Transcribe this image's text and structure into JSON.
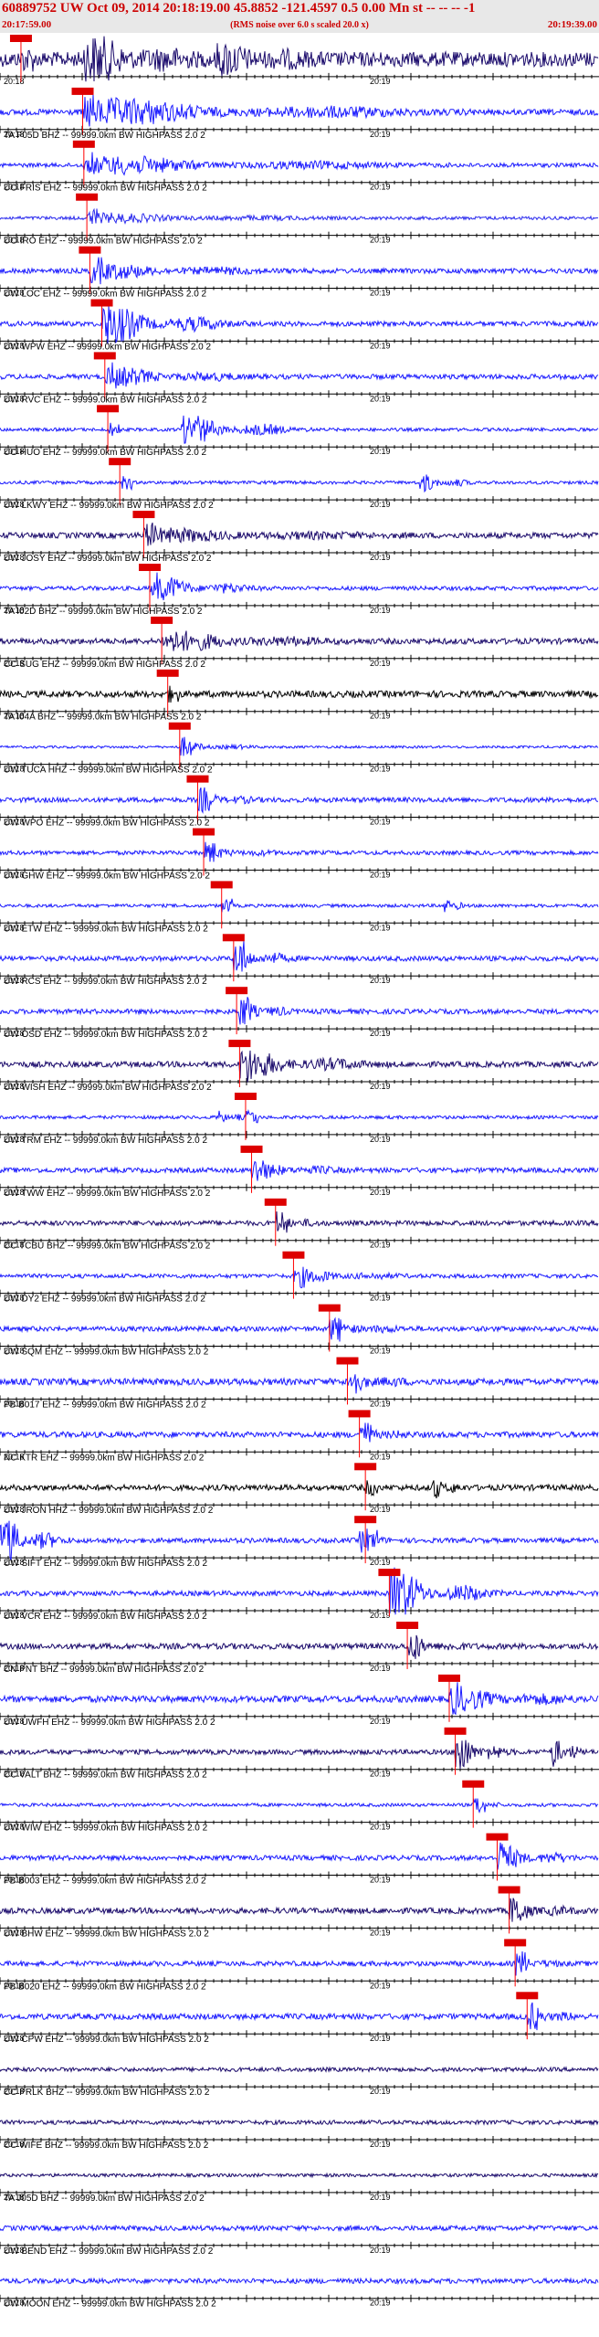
{
  "header": {
    "title": "60889752 UW Oct 09, 2014 20:18:19.00   45.8852 -121.4597  0.5 0.00 Mn st -- -- --  -1",
    "start_time": "20:17:59.00",
    "end_time": "20:19:39.00",
    "note": "(RMS noise over 6.0 s scaled 20.0 x)"
  },
  "ticks": {
    "left_label": "20:18",
    "right_label": "20:19"
  },
  "channels": [
    {
      "label": "",
      "color": "#1a0a6b",
      "pick": 0.035,
      "amp": 0.9,
      "bursts": [
        [
          0.14,
          0.36,
          1.4
        ],
        [
          0.36,
          0.55,
          0.9
        ]
      ]
    },
    {
      "label": "TA F05D BHZ -- 99999.0km BW  HIGHPASS  2.0  2",
      "color": "#1a1aff",
      "pick": 0.138,
      "amp": 0.35,
      "bursts": [
        [
          0.14,
          0.8,
          0.9
        ]
      ]
    },
    {
      "label": "UO FRIS EHZ -- 99999.0km BW  HIGHPASS  2.0  2",
      "color": "#1a1aff",
      "pick": 0.14,
      "amp": 0.25,
      "bursts": [
        [
          0.15,
          0.75,
          0.6
        ]
      ]
    },
    {
      "label": "UO IRO EHZ -- 99999.0km BW  HIGHPASS  2.0  2",
      "color": "#2a2aee",
      "pick": 0.145,
      "amp": 0.2,
      "bursts": [
        [
          0.15,
          0.6,
          0.3
        ]
      ]
    },
    {
      "label": "UW LOC EHZ -- 99999.0km BW  HIGHPASS  2.0  2",
      "color": "#1a1aff",
      "pick": 0.15,
      "amp": 0.3,
      "bursts": [
        [
          0.15,
          0.5,
          0.5
        ]
      ]
    },
    {
      "label": "UW WPW EHZ -- 99999.0km BW  HIGHPASS  2.0  2",
      "color": "#1a1aff",
      "pick": 0.17,
      "amp": 0.3,
      "bursts": [
        [
          0.17,
          0.42,
          1.3
        ]
      ]
    },
    {
      "label": "UW RVC EHZ -- 99999.0km BW  HIGHPASS  2.0  2",
      "color": "#1a1aff",
      "pick": 0.175,
      "amp": 0.3,
      "bursts": [
        [
          0.18,
          0.45,
          0.6
        ]
      ]
    },
    {
      "label": "UO HUO EHZ -- 99999.0km BW  HIGHPASS  2.0  2",
      "color": "#1a1aff",
      "pick": 0.18,
      "amp": 0.2,
      "bursts": [
        [
          0.3,
          0.52,
          1.1
        ]
      ]
    },
    {
      "label": "UW LKWY EHZ -- 99999.0km BW  HIGHPASS  2.0  2",
      "color": "#1a1aff",
      "pick": 0.2,
      "amp": 0.2,
      "bursts": [
        [
          0.7,
          0.8,
          0.6
        ]
      ]
    },
    {
      "label": "UW JOSY EHZ -- 99999.0km BW  HIGHPASS  2.0  2",
      "color": "#1a0a6b",
      "pick": 0.24,
      "amp": 0.35,
      "bursts": [
        [
          0.24,
          0.7,
          0.4
        ]
      ]
    },
    {
      "label": "TA I02D BHZ -- 99999.0km BW  HIGHPASS  2.0  2",
      "color": "#1a1aff",
      "pick": 0.25,
      "amp": 0.25,
      "bursts": [
        [
          0.26,
          0.45,
          0.8
        ]
      ]
    },
    {
      "label": "CC SUG EHZ -- 99999.0km BW  HIGHPASS  2.0  2",
      "color": "#1a0a6b",
      "pick": 0.27,
      "amp": 0.35,
      "bursts": [
        [
          0.28,
          0.6,
          0.6
        ]
      ]
    },
    {
      "label": "TA I04A BHZ -- 99999.0km BW  HIGHPASS  2.0  2",
      "color": "#000000",
      "pick": 0.28,
      "amp": 0.4,
      "bursts": []
    },
    {
      "label": "UW TUCA HHZ -- 99999.0km BW  HIGHPASS  2.0  2",
      "color": "#1a1aff",
      "pick": 0.3,
      "amp": 0.15,
      "bursts": [
        [
          0.3,
          0.45,
          0.3
        ]
      ]
    },
    {
      "label": "UW WPO EHZ -- 99999.0km BW  HIGHPASS  2.0  2",
      "color": "#1a1aff",
      "pick": 0.33,
      "amp": 0.3,
      "bursts": [
        [
          0.33,
          0.45,
          0.4
        ]
      ]
    },
    {
      "label": "UW GHW EHZ -- 99999.0km BW  HIGHPASS  2.0  2",
      "color": "#1a1aff",
      "pick": 0.34,
      "amp": 0.25,
      "bursts": [
        [
          0.34,
          0.5,
          0.3
        ]
      ]
    },
    {
      "label": "UW ETW EHZ -- 99999.0km BW  HIGHPASS  2.0  2",
      "color": "#1a1aff",
      "pick": 0.37,
      "amp": 0.2,
      "bursts": [
        [
          0.74,
          0.78,
          0.6
        ]
      ]
    },
    {
      "label": "UW RCS EHZ -- 99999.0km BW  HIGHPASS  2.0  2",
      "color": "#1a1aff",
      "pick": 0.39,
      "amp": 0.3,
      "bursts": [
        [
          0.39,
          0.5,
          0.9
        ]
      ]
    },
    {
      "label": "UW OSD EHZ -- 99999.0km BW  HIGHPASS  2.0  2",
      "color": "#1a1aff",
      "pick": 0.395,
      "amp": 0.3,
      "bursts": [
        [
          0.4,
          0.5,
          0.7
        ]
      ]
    },
    {
      "label": "UW WISH EHZ -- 99999.0km BW  HIGHPASS  2.0  2",
      "color": "#1a0a6b",
      "pick": 0.4,
      "amp": 0.35,
      "bursts": [
        [
          0.4,
          0.65,
          0.9
        ]
      ]
    },
    {
      "label": "UW TRM EHZ -- 99999.0km BW  HIGHPASS  2.0  2",
      "color": "#1a1aff",
      "pick": 0.41,
      "amp": 0.2,
      "bursts": [
        [
          0.36,
          0.42,
          0.4
        ]
      ]
    },
    {
      "label": "UW TWW EHZ -- 99999.0km BW  HIGHPASS  2.0  2",
      "color": "#1a1aff",
      "pick": 0.42,
      "amp": 0.3,
      "bursts": [
        [
          0.42,
          0.6,
          0.5
        ]
      ]
    },
    {
      "label": "CC TCBU BHZ -- 99999.0km BW  HIGHPASS  2.0  2",
      "color": "#1a0a6b",
      "pick": 0.46,
      "amp": 0.3,
      "bursts": [
        [
          0.46,
          0.55,
          0.4
        ]
      ]
    },
    {
      "label": "UW DY2 EHZ -- 99999.0km BW  HIGHPASS  2.0  2",
      "color": "#1a1aff",
      "pick": 0.49,
      "amp": 0.25,
      "bursts": [
        [
          0.5,
          0.7,
          0.4
        ]
      ]
    },
    {
      "label": "UW SQM EHZ -- 99999.0km BW  HIGHPASS  2.0  2",
      "color": "#1a1aff",
      "pick": 0.55,
      "amp": 0.3,
      "bursts": [
        [
          0.55,
          0.7,
          0.4
        ]
      ]
    },
    {
      "label": "PB B017 EHZ -- 99999.0km BW  HIGHPASS  2.0  2",
      "color": "#1a1aff",
      "pick": 0.58,
      "amp": 0.4,
      "bursts": [
        [
          0.58,
          0.7,
          0.5
        ]
      ]
    },
    {
      "label": "NC KTR EHZ -- 99999.0km BW  HIGHPASS  2.0  2",
      "color": "#1a1aff",
      "pick": 0.6,
      "amp": 0.35,
      "bursts": [
        [
          0.6,
          0.7,
          0.4
        ]
      ]
    },
    {
      "label": "UW JRON HHZ -- 99999.0km BW  HIGHPASS  2.0  2",
      "color": "#000000",
      "pick": 0.61,
      "amp": 0.35,
      "bursts": [
        [
          0.72,
          0.78,
          0.7
        ]
      ]
    },
    {
      "label": "UW SIFT EHZ -- 99999.0km BW  HIGHPASS  2.0  2",
      "color": "#1a1aff",
      "pick": 0.61,
      "amp": 0.3,
      "bursts": [
        [
          0.0,
          0.12,
          1.6
        ],
        [
          0.6,
          0.65,
          0.8
        ]
      ]
    },
    {
      "label": "UW VCR EHZ -- 99999.0km BW  HIGHPASS  2.0  2",
      "color": "#1a1aff",
      "pick": 0.65,
      "amp": 0.3,
      "bursts": [
        [
          0.65,
          0.85,
          1.6
        ]
      ]
    },
    {
      "label": "CN PNT BHZ -- 99999.0km BW  HIGHPASS  2.0  2",
      "color": "#1a0a6b",
      "pick": 0.68,
      "amp": 0.35,
      "bursts": [
        [
          0.68,
          0.8,
          0.5
        ]
      ]
    },
    {
      "label": "UW UWFH EHZ -- 99999.0km BW  HIGHPASS  2.0  2",
      "color": "#1a1aff",
      "pick": 0.75,
      "amp": 0.4,
      "bursts": [
        [
          0.75,
          1.0,
          0.7
        ]
      ]
    },
    {
      "label": "CC VALT BHZ -- 99999.0km BW  HIGHPASS  2.0  2",
      "color": "#1a0a6b",
      "pick": 0.76,
      "amp": 0.3,
      "bursts": [
        [
          0.76,
          0.86,
          1.3
        ],
        [
          0.92,
          0.98,
          1.1
        ]
      ]
    },
    {
      "label": "UW WIW EHZ -- 99999.0km BW  HIGHPASS  2.0  2",
      "color": "#1a1aff",
      "pick": 0.79,
      "amp": 0.2,
      "bursts": [
        [
          0.79,
          0.85,
          0.3
        ]
      ]
    },
    {
      "label": "PB B003 EHZ -- 99999.0km BW  HIGHPASS  2.0  2",
      "color": "#1a1aff",
      "pick": 0.83,
      "amp": 0.3,
      "bursts": [
        [
          0.83,
          0.98,
          0.8
        ]
      ]
    },
    {
      "label": "UW BHW EHZ -- 99999.0km BW  HIGHPASS  2.0  2",
      "color": "#1a0a6b",
      "pick": 0.85,
      "amp": 0.35,
      "bursts": [
        [
          0.85,
          0.98,
          0.6
        ]
      ]
    },
    {
      "label": "PB B020 EHZ -- 99999.0km BW  HIGHPASS  2.0  2",
      "color": "#1a1aff",
      "pick": 0.86,
      "amp": 0.3,
      "bursts": [
        [
          0.86,
          0.95,
          0.4
        ]
      ]
    },
    {
      "label": "UW CPW EHZ -- 99999.0km BW  HIGHPASS  2.0  2",
      "color": "#1a1aff",
      "pick": 0.88,
      "amp": 0.35,
      "bursts": [
        [
          0.88,
          0.98,
          0.5
        ]
      ]
    },
    {
      "label": "CC PRLK BHZ -- 99999.0km BW  HIGHPASS  2.0  2",
      "color": "#1a0a6b",
      "pick": null,
      "amp": 0.25,
      "bursts": []
    },
    {
      "label": "CC WIFE BHZ -- 99999.0km BW  HIGHPASS  2.0  2",
      "color": "#1a0a6b",
      "pick": null,
      "amp": 0.25,
      "bursts": []
    },
    {
      "label": "TA J05D BHZ -- 99999.0km BW  HIGHPASS  2.0  2",
      "color": "#1a0a6b",
      "pick": null,
      "amp": 0.2,
      "bursts": []
    },
    {
      "label": "UW BEND EHZ -- 99999.0km BW  HIGHPASS  2.0  2",
      "color": "#1a1aff",
      "pick": null,
      "amp": 0.3,
      "bursts": []
    },
    {
      "label": "UW MOON EHZ -- 99999.0km BW  HIGHPASS  2.0  2",
      "color": "#1a1aff",
      "pick": null,
      "amp": 0.3,
      "bursts": []
    }
  ]
}
